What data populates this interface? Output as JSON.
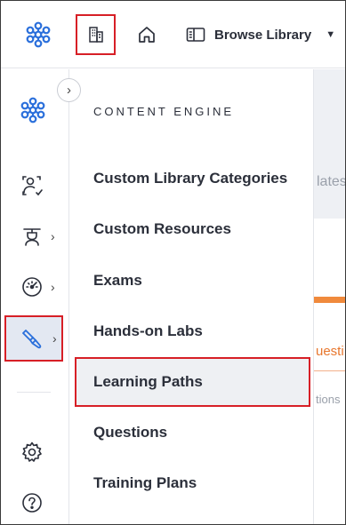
{
  "topbar": {
    "browse_label": "Browse Library",
    "icons": [
      "logo-icon",
      "building-icon",
      "home-icon",
      "library-icon",
      "caret-down-icon"
    ]
  },
  "rail": {
    "items": [
      {
        "name": "users",
        "icon": "users-icon",
        "has_submenu": false
      },
      {
        "name": "instructor",
        "icon": "instructor-icon",
        "has_submenu": true
      },
      {
        "name": "dashboard",
        "icon": "speedometer-icon",
        "has_submenu": true
      },
      {
        "name": "content-engine",
        "icon": "brush-icon",
        "has_submenu": true,
        "active": true
      },
      {
        "name": "settings",
        "icon": "gear-icon",
        "has_submenu": false
      },
      {
        "name": "help",
        "icon": "help-icon",
        "has_submenu": false
      }
    ]
  },
  "flyout": {
    "title": "CONTENT ENGINE",
    "items": [
      {
        "label": "Custom Library Categories"
      },
      {
        "label": "Custom Resources"
      },
      {
        "label": "Exams"
      },
      {
        "label": "Hands-on Labs"
      },
      {
        "label": "Learning Paths",
        "active": true
      },
      {
        "label": "Questions"
      },
      {
        "label": "Training Plans"
      }
    ]
  },
  "background": {
    "text1": "lates",
    "text2": "uesti",
    "text3": "tions"
  },
  "colors": {
    "highlight_border": "#d71f26",
    "logo_blue": "#2a6fdb",
    "accent_orange": "#f08a3c"
  }
}
